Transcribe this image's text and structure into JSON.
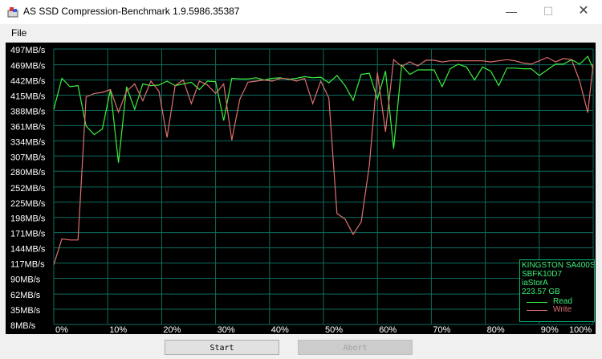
{
  "window": {
    "title": "AS SSD Compression-Benchmark 1.9.5986.35387",
    "minimize_glyph": "—",
    "maximize_glyph": "☐",
    "close_glyph": "✕"
  },
  "menu": {
    "items": [
      "File"
    ]
  },
  "legend": {
    "device_lines": [
      "KINGSTON SA400S",
      "SBFK10D7",
      "iaStorA",
      "223.57 GB"
    ],
    "read_label": "Read",
    "write_label": "Write"
  },
  "buttons": {
    "start": "Start",
    "abort": "Abort"
  },
  "colors": {
    "read": "#3cf03c",
    "write": "#e07070",
    "grid": "#0e6c5e",
    "legend_text": "#3cf07a",
    "background": "#000000"
  },
  "chart_data": {
    "type": "line",
    "y_tick_labels": [
      "497MB/s",
      "469MB/s",
      "442MB/s",
      "415MB/s",
      "388MB/s",
      "361MB/s",
      "334MB/s",
      "307MB/s",
      "280MB/s",
      "252MB/s",
      "225MB/s",
      "198MB/s",
      "171MB/s",
      "144MB/s",
      "117MB/s",
      "90MB/s",
      "62MB/s",
      "35MB/s",
      "8MB/s"
    ],
    "y_tick_values": [
      497,
      469,
      442,
      415,
      388,
      361,
      334,
      307,
      280,
      252,
      225,
      198,
      171,
      144,
      117,
      90,
      62,
      35,
      8
    ],
    "x_tick_labels": [
      "0%",
      "10%",
      "20%",
      "30%",
      "40%",
      "50%",
      "60%",
      "70%",
      "80%",
      "90%",
      "100%"
    ],
    "x_tick_values": [
      0,
      10,
      20,
      30,
      40,
      50,
      60,
      70,
      80,
      90,
      100
    ],
    "xlim": [
      0,
      100
    ],
    "ylim": [
      8,
      497
    ],
    "grid": true,
    "legend_position": "bottom-right",
    "series": [
      {
        "name": "Read",
        "x": [
          0,
          1.5,
          3,
          4.5,
          6,
          7.5,
          9,
          10.5,
          12,
          13.5,
          15,
          16.5,
          18,
          19.5,
          21,
          22.5,
          24,
          25.5,
          27,
          28.5,
          30,
          31.5,
          33,
          34.5,
          36,
          37.5,
          39,
          40.5,
          42,
          43.5,
          45,
          46.5,
          48,
          49.5,
          51,
          52.5,
          54,
          55.5,
          57,
          58.5,
          60,
          61.5,
          63,
          64.5,
          66,
          67.5,
          69,
          70.5,
          72,
          73.5,
          75,
          76.5,
          78,
          79.5,
          81,
          82.5,
          84,
          85.5,
          87,
          88.5,
          90,
          91.5,
          93,
          94.5,
          96,
          97.5,
          99,
          100
        ],
        "y": [
          390,
          445,
          430,
          432,
          360,
          345,
          355,
          425,
          295,
          430,
          390,
          435,
          432,
          433,
          440,
          432,
          435,
          438,
          425,
          440,
          439,
          370,
          445,
          444,
          444,
          446,
          442,
          445,
          446,
          443,
          445,
          448,
          446,
          447,
          437,
          450,
          432,
          406,
          452,
          454,
          408,
          458,
          320,
          468,
          452,
          460,
          460,
          460,
          430,
          462,
          470,
          465,
          442,
          465,
          458,
          432,
          463,
          463,
          462,
          462,
          450,
          460,
          470,
          470,
          478,
          470,
          484,
          462
        ]
      },
      {
        "name": "Write",
        "x": [
          0,
          1.5,
          3,
          4.5,
          6,
          7.5,
          9,
          10.5,
          12,
          13.5,
          15,
          16.5,
          18,
          19.5,
          21,
          22.5,
          24,
          25.5,
          27,
          28.5,
          30,
          31.5,
          33,
          34.5,
          36,
          37.5,
          39,
          40.5,
          42,
          43.5,
          45,
          46.5,
          48,
          49.5,
          51,
          52.5,
          54,
          55.5,
          57,
          58.5,
          60,
          61.5,
          63,
          64.5,
          66,
          67.5,
          69,
          70.5,
          72,
          73.5,
          75,
          76.5,
          78,
          79.5,
          81,
          82.5,
          84,
          85.5,
          87,
          88.5,
          90,
          91.5,
          93,
          94.5,
          96,
          97.5,
          99,
          100
        ],
        "y": [
          114,
          160,
          158,
          158,
          412,
          418,
          420,
          425,
          385,
          422,
          435,
          405,
          440,
          422,
          340,
          432,
          442,
          400,
          440,
          433,
          418,
          435,
          335,
          408,
          438,
          440,
          442,
          440,
          445,
          444,
          440,
          445,
          400,
          440,
          410,
          205,
          195,
          168,
          190,
          290,
          455,
          350,
          478,
          466,
          474,
          467,
          477,
          477,
          474,
          476,
          476,
          476,
          476,
          476,
          474,
          476,
          478,
          476,
          472,
          470,
          476,
          482,
          474,
          480,
          478,
          440,
          384,
          470
        ]
      }
    ]
  }
}
